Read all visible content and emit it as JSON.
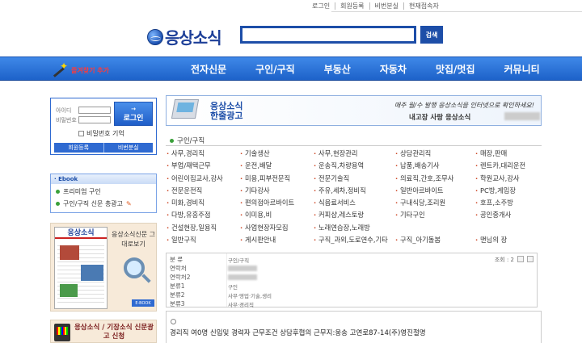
{
  "toplinks": [
    "로그인",
    "회원등록",
    "비번분실",
    "현재접속자"
  ],
  "logo": {
    "text": "응상소식"
  },
  "search": {
    "value": "",
    "button_label": "검색"
  },
  "favorite_label": "즐겨찾기 추가",
  "nav": [
    "전자신문",
    "구인/구직",
    "부동산",
    "자동차",
    "맛집/멋집",
    "커뮤니티"
  ],
  "login": {
    "id_label": "아이디",
    "pw_label": "비밀번호",
    "button_label": "로그인",
    "button_arrow": "→",
    "keep_label": "비밀번호 기억",
    "register_label": "회원등록",
    "lost_pw_label": "비번분실"
  },
  "ebook": {
    "header": "Ebook",
    "items": [
      "프리미엄 구인",
      "구인/구직 신문 총광고"
    ]
  },
  "promo": {
    "paper_title": "응상소식",
    "title": "응상소식신문 그대로보기",
    "button_label": "E-BOOK"
  },
  "ad": {
    "text": "응상소식 / 기장소식 신문광고 신청"
  },
  "banner": {
    "title_line1": "응상소식",
    "title_line2": "한줄광고",
    "desc": "매주 월/수 발행 응상소식을 인터넷으로 확인하세요!",
    "sub": "내고장 사랑 응상소식"
  },
  "section": {
    "title": "구인/구직"
  },
  "categories": [
    "사무,경리직",
    "기술생산",
    "사무,현장관리",
    "상담관리직",
    "매장,판매",
    "부업/재택근무",
    "운전,배달",
    "운송직,차량용역",
    "납품,배송기사",
    "렌트카,대리운전",
    "어린이집교사,강사",
    "미용,피부전문직",
    "전문기술직",
    "의료직,간호,조무사",
    "학원교사,강사",
    "전문운전직",
    "기타강사",
    "주유,세차,정비직",
    "일반아르바이트",
    "PC방,게임장",
    "미화,경비직",
    "편의점아르바이트",
    "식음료서비스",
    "구내식당,조리원",
    "호프,소주방",
    "다방,유흥주점",
    "이미용,비",
    "커피샵,레스토랑",
    "기타구인",
    "공인중개사",
    "건설현장,일용직",
    "사업현장자모집",
    "노래연습장,노래방",
    "",
    "",
    "일반구직",
    "게시판안내",
    "구직_과외,도로연수,기타",
    "구직_아기돌봄",
    "맨님의 장"
  ],
  "detail": {
    "rows": [
      {
        "key": "분 류",
        "value": "구인/구직"
      },
      {
        "key": "연락처",
        "value": ""
      },
      {
        "key": "연락처2",
        "value": ""
      },
      {
        "key": "분류1",
        "value": "구인"
      },
      {
        "key": "분류2",
        "value": "사무·영업·기술,생리"
      },
      {
        "key": "분류3",
        "value": "사무·경리직"
      }
    ],
    "views": "조회 : 2"
  },
  "content": {
    "body": "경리직 여0명 신입및 경력자 근무조건 상담후협의 근무지:웅송 고연로87-14(주)영진절명"
  }
}
